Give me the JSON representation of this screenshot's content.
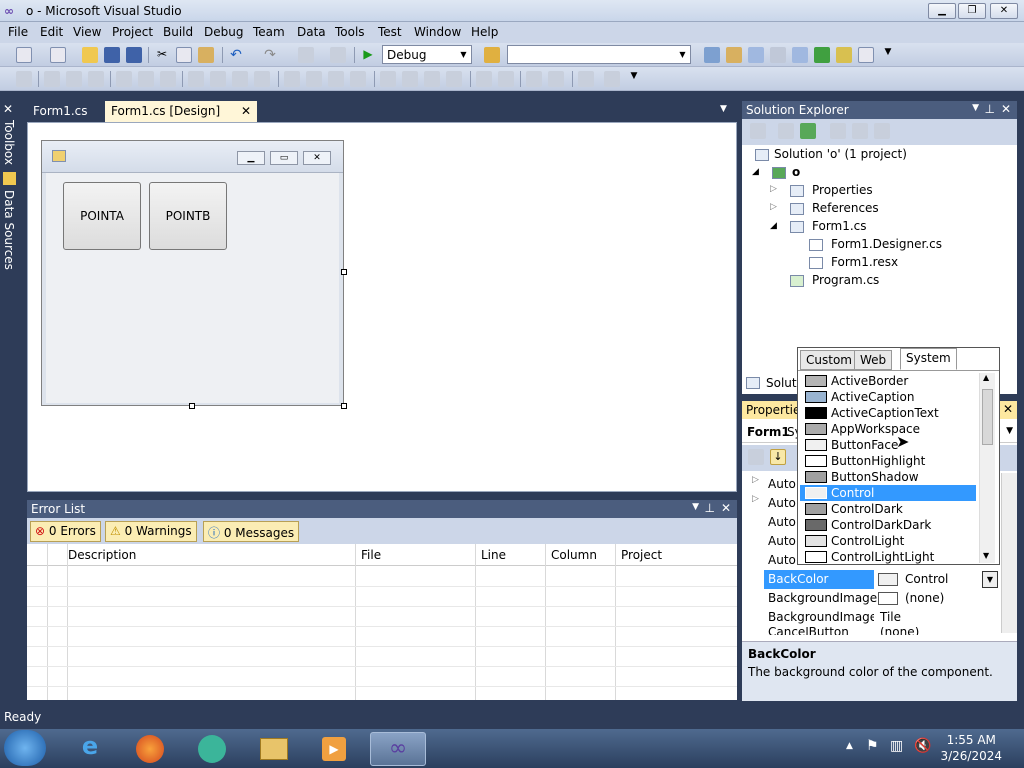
{
  "window": {
    "title": "o - Microsoft Visual Studio"
  },
  "menu": [
    "File",
    "Edit",
    "View",
    "Project",
    "Build",
    "Debug",
    "Team",
    "Data",
    "Tools",
    "Test",
    "Window",
    "Help"
  ],
  "toolbar": {
    "config": "Debug",
    "platform": ""
  },
  "side_tabs": [
    "Toolbox",
    "Data Sources"
  ],
  "doc_tabs": [
    {
      "label": "Form1.cs"
    },
    {
      "label": "Form1.cs [Design]"
    }
  ],
  "form": {
    "buttons": [
      "POINTA",
      "POINTB"
    ]
  },
  "error_list": {
    "title": "Error List",
    "errors": "0 Errors",
    "warnings": "0 Warnings",
    "messages": "0 Messages",
    "columns": [
      "Description",
      "File",
      "Line",
      "Column",
      "Project"
    ]
  },
  "solution_explorer": {
    "title": "Solution Explorer",
    "root": "Solution 'o' (1 project)",
    "project": "o",
    "items": [
      "Properties",
      "References",
      "Form1.cs",
      "Form1.Designer.cs",
      "Form1.resx",
      "Program.cs"
    ],
    "bottom_tab": "Soluti"
  },
  "properties": {
    "title": "Properties",
    "object": "Form1",
    "object_suffix": "Sy",
    "rows": [
      {
        "name": "Auto",
        "value": ""
      },
      {
        "name": "Auto",
        "value": ""
      },
      {
        "name": "Auto",
        "value": ""
      },
      {
        "name": "Auto",
        "value": ""
      },
      {
        "name": "Auto",
        "value": ""
      },
      {
        "name": "BackColor",
        "value": "Control"
      },
      {
        "name": "BackgroundImage",
        "value": "(none)"
      },
      {
        "name": "BackgroundImageLa",
        "value": "Tile"
      },
      {
        "name": "CancelButton",
        "value": "(none)"
      }
    ],
    "desc_title": "BackColor",
    "desc_text": "The background color of the component."
  },
  "color_popup": {
    "tabs": [
      "Custom",
      "Web",
      "System"
    ],
    "items": [
      {
        "name": "ActiveBorder",
        "color": "#b4b4b4"
      },
      {
        "name": "ActiveCaption",
        "color": "#99b4d1"
      },
      {
        "name": "ActiveCaptionText",
        "color": "#000000"
      },
      {
        "name": "AppWorkspace",
        "color": "#ababab"
      },
      {
        "name": "ButtonFace",
        "color": "#f0f0f0"
      },
      {
        "name": "ButtonHighlight",
        "color": "#ffffff"
      },
      {
        "name": "ButtonShadow",
        "color": "#a0a0a0"
      },
      {
        "name": "Control",
        "color": "#f0f0f0"
      },
      {
        "name": "ControlDark",
        "color": "#a0a0a0"
      },
      {
        "name": "ControlDarkDark",
        "color": "#696969"
      },
      {
        "name": "ControlLight",
        "color": "#e3e3e3"
      },
      {
        "name": "ControlLightLight",
        "color": "#ffffff"
      }
    ]
  },
  "status": {
    "text": "Ready"
  },
  "clock": {
    "time": "1:55 AM",
    "date": "3/26/2024"
  }
}
